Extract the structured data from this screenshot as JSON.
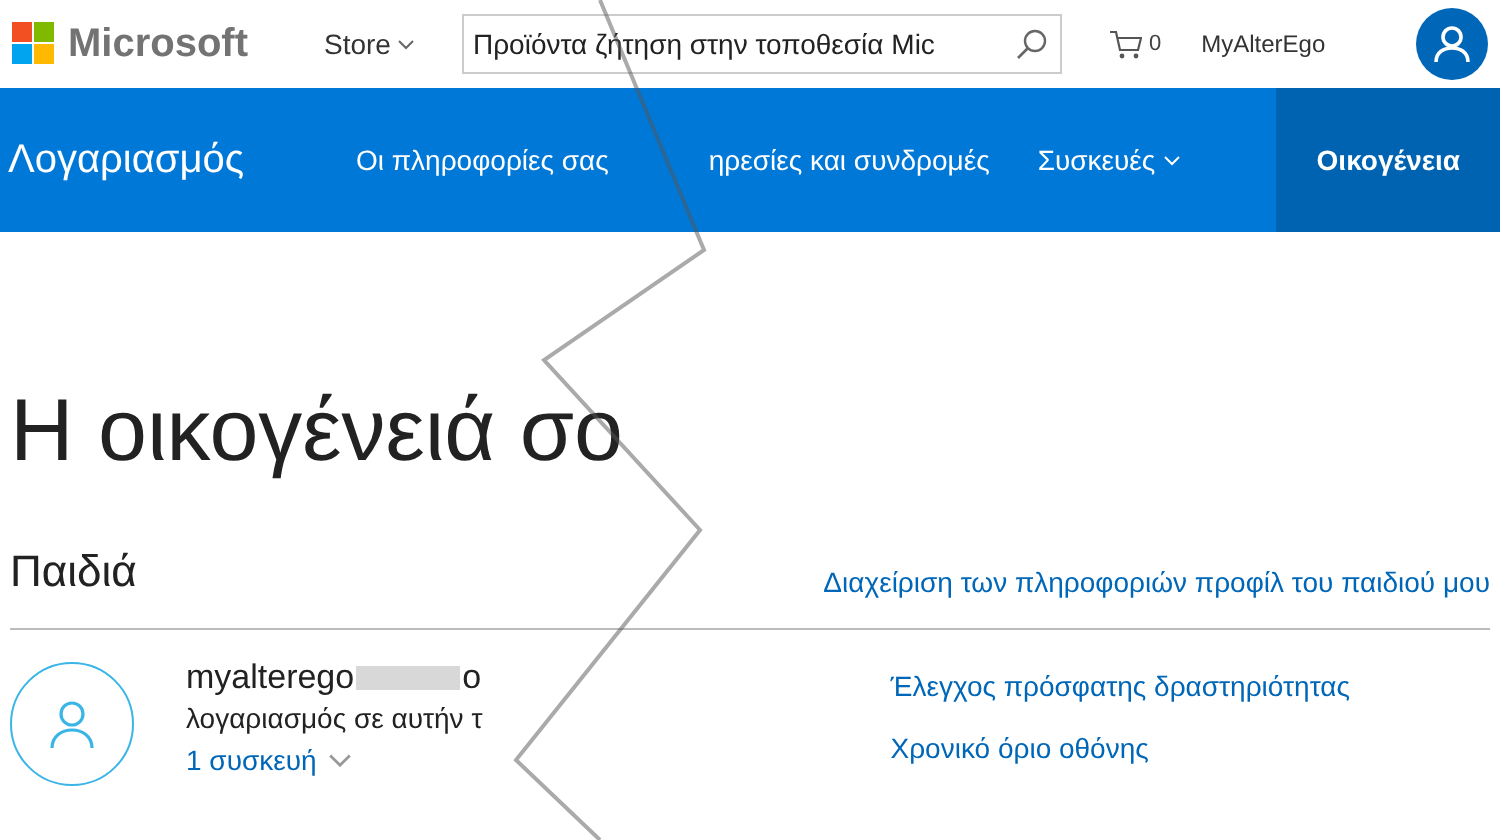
{
  "header": {
    "logo": "Microsoft",
    "store": "Store",
    "search": {
      "placeholder": "Προϊόντα ζήτηση στην τοποθεσία Mic"
    },
    "cart_count": "0",
    "user": "MyAlterEgo"
  },
  "nav": {
    "title": "Λογαριασμός",
    "items": [
      {
        "label": "Οι πληροφορίες σας",
        "selected": false,
        "dropdown": false
      },
      {
        "label": "ηρεσίες και συνδρομές",
        "selected": false,
        "dropdown": false
      },
      {
        "label": "Συσκευές",
        "selected": false,
        "dropdown": true
      },
      {
        "label": "Οικογένεια",
        "selected": true,
        "dropdown": false
      }
    ]
  },
  "heading": "Η οικογένειά σο",
  "children_section": {
    "title": "Παιδιά",
    "manage_link": "Διαχείριση των πληροφοριών προφίλ του παιδιού μου",
    "child": {
      "name": "myalterego",
      "name_end": "o",
      "description": "λογαριασμός σε αυτήν τ",
      "devices": "1 συσκευή",
      "actions": [
        "Έλεγχος πρόσφατης δραστηριότητας",
        "Χρονικό όριο οθόνης"
      ]
    }
  }
}
